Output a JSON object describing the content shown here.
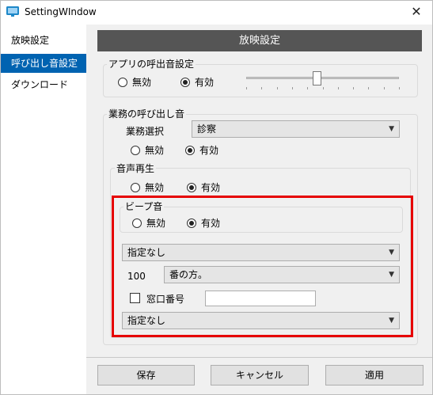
{
  "window": {
    "title": "SettingWIndow",
    "close_glyph": "✕",
    "app_icon": "monitor-icon"
  },
  "sidebar": {
    "items": [
      {
        "label": "放映設定"
      },
      {
        "label": "呼び出し音設定"
      },
      {
        "label": "ダウンロード"
      }
    ],
    "selected_index": 1
  },
  "header": {
    "title": "放映設定"
  },
  "app_call_sound": {
    "legend": "アプリの呼出音設定",
    "disabled_label": "無効",
    "enabled_label": "有効",
    "selected": "有効",
    "volume_fraction": 0.46
  },
  "work_call_sound": {
    "legend": "業務の呼び出し音",
    "work_select_label": "業務選択",
    "work_select_value": "診察",
    "disabled_label": "無効",
    "enabled_label": "有効",
    "selected": "有効"
  },
  "voice_playback": {
    "legend": "音声再生",
    "disabled_label": "無効",
    "enabled_label": "有効",
    "selected": "有効"
  },
  "beep": {
    "legend": "ビープ音",
    "disabled_label": "無効",
    "enabled_label": "有効",
    "selected": "有効"
  },
  "announce": {
    "prefix_select_value": "指定なし",
    "number_label": "100",
    "number_suffix_select_value": "番の方。",
    "window_no_label": "窓口番号",
    "window_no_checked": false,
    "window_no_value": "",
    "suffix_select_value": "指定なし"
  },
  "footer": {
    "save_label": "保存",
    "cancel_label": "キャンセル",
    "apply_label": "適用"
  },
  "colors": {
    "highlight": "#e60000",
    "selected_nav": "#0063b1",
    "header_bar": "#555555"
  }
}
